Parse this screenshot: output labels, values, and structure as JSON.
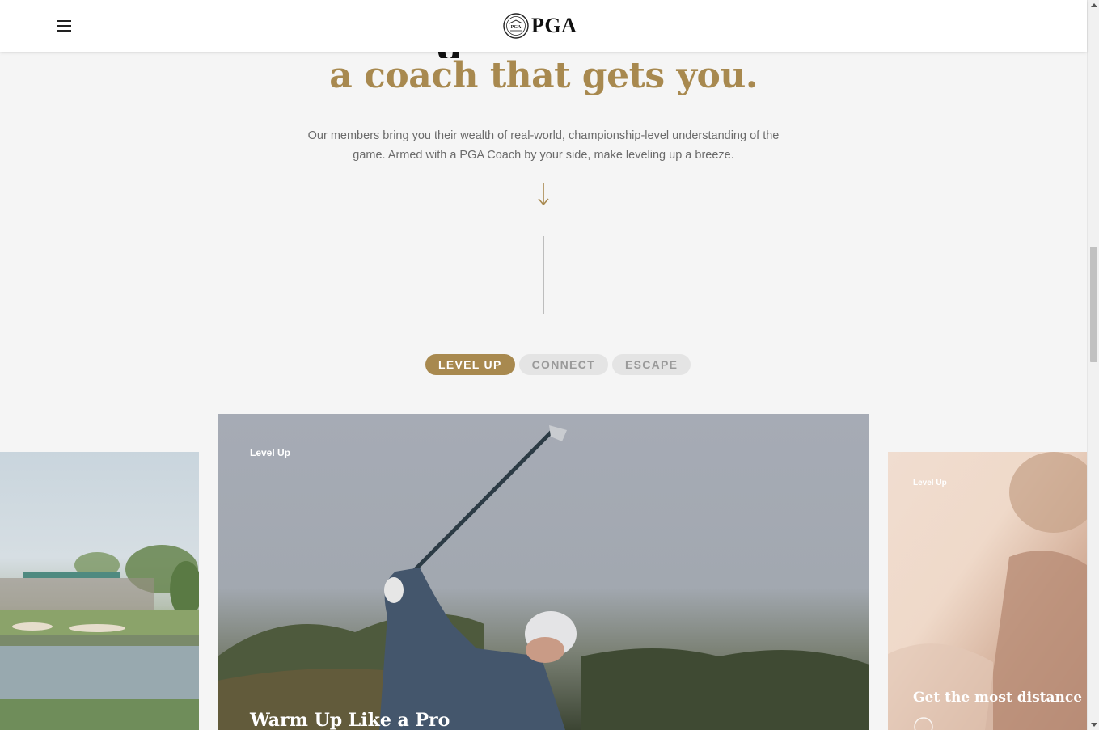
{
  "header": {
    "logo_text": "PGA",
    "menu_icon": "hamburger-menu-icon",
    "logo_icon": "pga-seal-icon"
  },
  "hero": {
    "headline": "a coach that gets you.",
    "lead": "Our members bring you their wealth of real-world, championship-level understanding of the game. Armed with a PGA Coach by your side, make leveling up a breeze.",
    "arrow_icon": "down-arrow-icon"
  },
  "tabs": [
    {
      "label": "LEVEL UP",
      "active": true
    },
    {
      "label": "CONNECT",
      "active": false
    },
    {
      "label": "ESCAPE",
      "active": false
    }
  ],
  "cards": {
    "main": {
      "tag": "Level Up",
      "title": "Warm Up Like a Pro"
    },
    "right": {
      "tag": "Level Up",
      "title": "Get the most distance ou"
    }
  },
  "colors": {
    "accent": "#a8894f",
    "background": "#f5f5f5",
    "tab_inactive_bg": "#e4e4e4",
    "tab_inactive_text": "#9a9a9a"
  }
}
